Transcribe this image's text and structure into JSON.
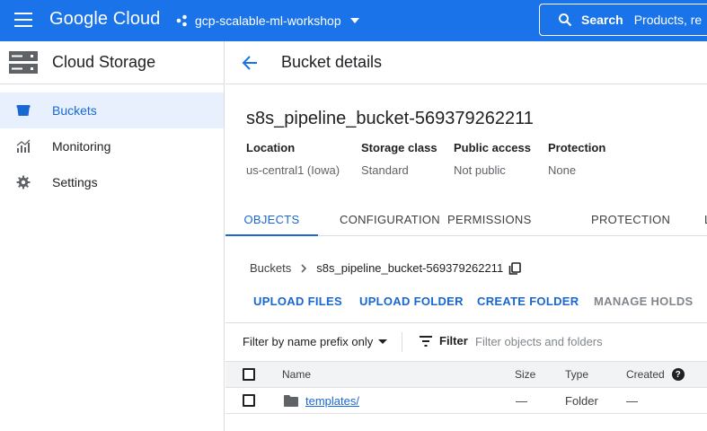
{
  "topbar": {
    "brand": "Google Cloud",
    "project": "gcp-scalable-ml-workshop",
    "search_label": "Search",
    "search_hint": "Products, re"
  },
  "nav": {
    "product_title": "Cloud Storage",
    "items": [
      {
        "label": "Buckets",
        "icon": "bucket-icon",
        "active": true
      },
      {
        "label": "Monitoring",
        "icon": "monitoring-chart-icon",
        "active": false
      },
      {
        "label": "Settings",
        "icon": "gear-icon",
        "active": false
      }
    ]
  },
  "page": {
    "title": "Bucket details",
    "bucket_name": "s8s_pipeline_bucket-569379262211"
  },
  "meta": [
    {
      "key": "Location",
      "value": "us-central1 (Iowa)"
    },
    {
      "key": "Storage class",
      "value": "Standard"
    },
    {
      "key": "Public access",
      "value": "Not public"
    },
    {
      "key": "Protection",
      "value": "None"
    }
  ],
  "tabs": [
    {
      "label": "OBJECTS",
      "active": true
    },
    {
      "label": "CONFIGURATION",
      "active": false
    },
    {
      "label": "PERMISSIONS",
      "active": false
    },
    {
      "label": "PROTECTION",
      "active": false
    },
    {
      "label": "L",
      "active": false
    }
  ],
  "breadcrumb": {
    "root": "Buckets",
    "current": "s8s_pipeline_bucket-569379262211"
  },
  "actions": [
    {
      "label": "UPLOAD FILES",
      "disabled": false
    },
    {
      "label": "UPLOAD FOLDER",
      "disabled": false
    },
    {
      "label": "CREATE FOLDER",
      "disabled": false
    },
    {
      "label": "MANAGE HOLDS",
      "disabled": true
    }
  ],
  "filter": {
    "prefix_label": "Filter by name prefix only",
    "button_label": "Filter",
    "placeholder": "Filter objects and folders"
  },
  "table": {
    "columns": [
      "Name",
      "Size",
      "Type",
      "Created"
    ],
    "rows": [
      {
        "name": "templates/",
        "size": "—",
        "type": "Folder",
        "created": "—"
      }
    ]
  },
  "colors": {
    "brand_blue": "#1a73e8",
    "active_blue": "#1967d2",
    "active_nav_bg": "#e8f0fe"
  }
}
